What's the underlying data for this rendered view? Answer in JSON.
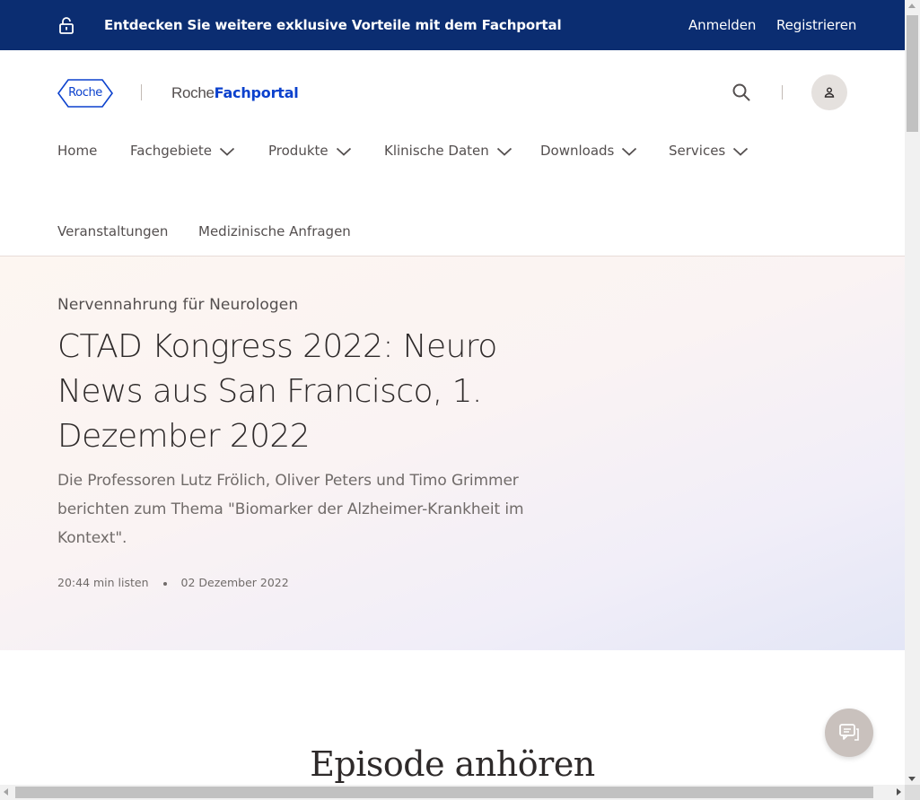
{
  "topbar": {
    "promo": "Entdecken Sie weitere exklusive Vorteile mit dem Fachportal",
    "login": "Anmelden",
    "register": "Registrieren",
    "icon": "unlock-icon"
  },
  "header": {
    "logo_text": "Roche",
    "portal_part1": "Roche",
    "portal_part2": "Fachportal",
    "search_icon": "search-icon",
    "user_icon": "user-icon"
  },
  "nav": {
    "items": [
      {
        "label": "Home",
        "has_dropdown": false
      },
      {
        "label": "Fachgebiete",
        "has_dropdown": true
      },
      {
        "label": "Produkte",
        "has_dropdown": true
      },
      {
        "label": "Klinische Daten",
        "has_dropdown": true
      },
      {
        "label": "Downloads",
        "has_dropdown": true
      },
      {
        "label": "Services",
        "has_dropdown": true
      },
      {
        "label": "Veranstaltungen",
        "has_dropdown": false
      },
      {
        "label": "Medizinische Anfragen",
        "has_dropdown": false
      }
    ]
  },
  "hero": {
    "eyebrow": "Nervennahrung für Neurologen",
    "title_line1": "CTAD Kongress 2022: Neuro",
    "title_line2": "News aus San Francisco, 1.",
    "title_line3": "Dezember 2022",
    "desc_line1": "Die Professoren Lutz Frölich, Oliver Peters und Timo Grimmer",
    "desc_line2": "berichten zum Thema \"Biomarker der Alzheimer-Krankheit im",
    "desc_line3": "Kontext\".",
    "duration": "20:44 min listen",
    "date": "02 Dezember 2022"
  },
  "episode": {
    "heading": "Episode anhören"
  },
  "chat": {
    "icon": "chat-icon"
  },
  "colors": {
    "topbar_bg": "#0b2d71",
    "brand_blue": "#0b41cd",
    "text": "#544f4f",
    "chat_bg": "#c9c1bd"
  }
}
